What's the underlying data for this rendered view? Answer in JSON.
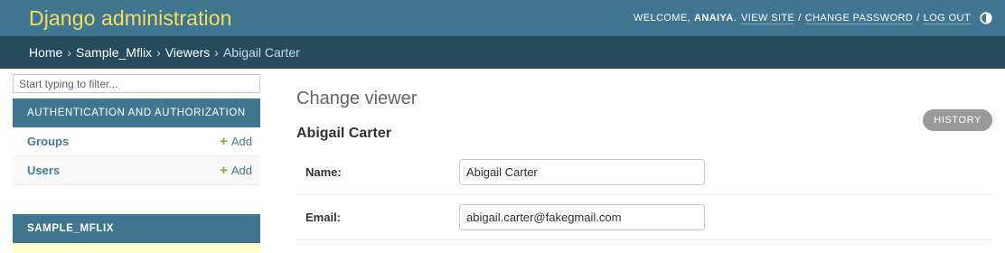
{
  "header": {
    "brand": "Django administration",
    "welcome": "WELCOME,",
    "username": "ANAIYA",
    "view_site": "VIEW SITE",
    "change_password": "CHANGE PASSWORD",
    "log_out": "LOG OUT",
    "separator": "/",
    "theme_icon": "theme-toggle-icon"
  },
  "breadcrumbs": {
    "items": [
      "Home",
      "Sample_Mflix",
      "Viewers"
    ],
    "current": "Abigail Carter",
    "separator": "›"
  },
  "sidebar": {
    "filter_placeholder": "Start typing to filter...",
    "modules": [
      {
        "caption": "AUTHENTICATION AND AUTHORIZATION",
        "models": [
          {
            "label": "Groups",
            "add_label": "Add"
          },
          {
            "label": "Users",
            "add_label": "Add"
          }
        ]
      },
      {
        "caption": "SAMPLE_MFLIX"
      }
    ]
  },
  "main": {
    "page_title": "Change viewer",
    "history_label": "HISTORY",
    "object_title": "Abigail Carter",
    "fields": {
      "name_label": "Name:",
      "name_value": "Abigail Carter",
      "email_label": "Email:",
      "email_value": "abigail.carter@fakegmail.com"
    }
  },
  "colors": {
    "header_bg": "#417690",
    "brand": "#f5dd5d",
    "breadcrumbs_bg": "#264b5d",
    "link": "#447e9b",
    "add_icon": "#70bf2b",
    "history_bg": "#999999"
  }
}
